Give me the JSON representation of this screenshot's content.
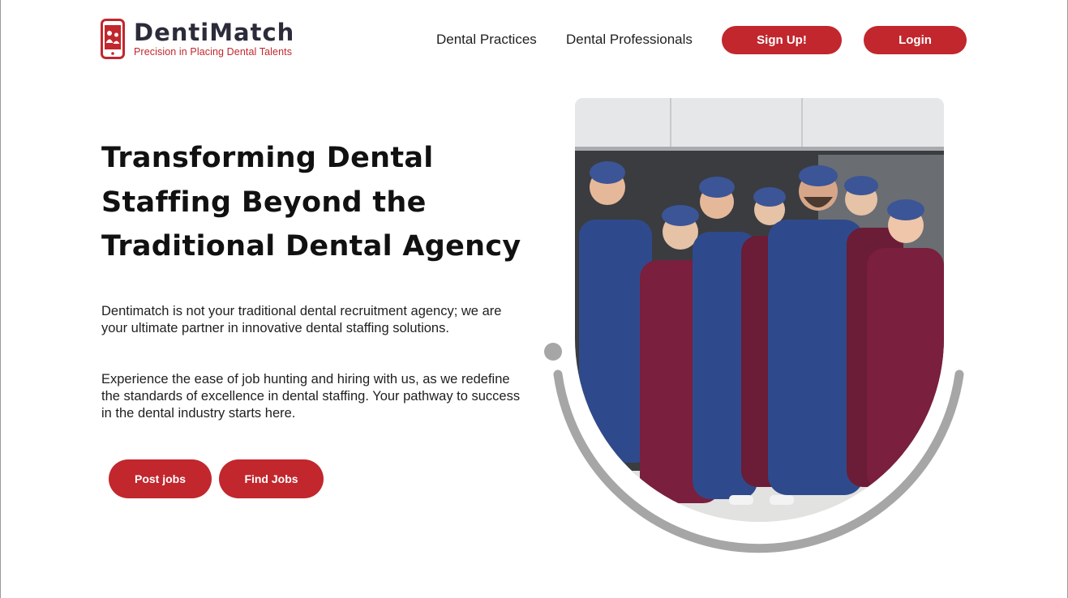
{
  "header": {
    "brand": "DentiMatch",
    "tagline": "Precision in Placing Dental Talents",
    "nav": {
      "practices": "Dental Practices",
      "professionals": "Dental Professionals"
    },
    "signup_label": "Sign Up!",
    "login_label": "Login"
  },
  "hero": {
    "title": "Transforming Dental Staffing Beyond the Traditional Dental Agency",
    "paragraph1": "Dentimatch is not your traditional dental recruitment agency; we are your ultimate partner in innovative dental staffing solutions.",
    "paragraph2": "Experience the ease of job hunting and hiring with us, as we redefine the standards of excellence in dental staffing. Your pathway to success in the dental industry starts here.",
    "post_jobs_label": "Post jobs",
    "find_jobs_label": "Find Jobs"
  },
  "colors": {
    "accent": "#c1272d",
    "arc": "#a6a6a6",
    "navy_scrubs": "#2f4a8c",
    "burgundy_scrubs": "#7a1f3d"
  },
  "icons": {
    "logo": "phone-with-people-icon"
  }
}
